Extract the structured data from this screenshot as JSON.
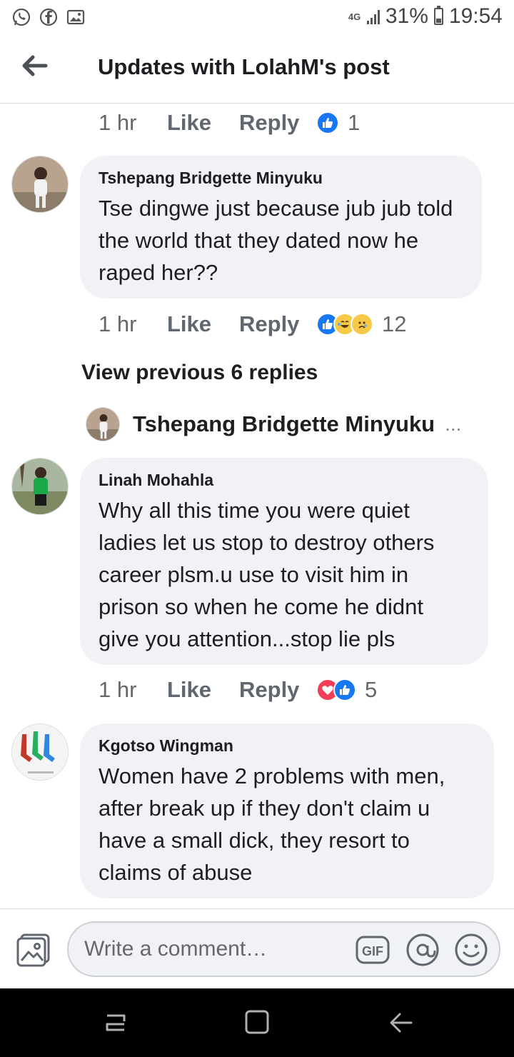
{
  "status_bar": {
    "network": "4G",
    "battery": "31%",
    "time": "19:54",
    "left_icons": [
      "whatsapp-icon",
      "facebook-icon",
      "gallery-icon"
    ]
  },
  "header": {
    "title": "Updates with LolahM's post",
    "back_icon": "back-arrow-icon"
  },
  "rows": [
    {
      "time": "1 hr",
      "like": "Like",
      "reply": "Reply",
      "reactions": [
        "like"
      ],
      "count": "1"
    },
    {
      "time": "1 hr",
      "like": "Like",
      "reply": "Reply",
      "reactions": [
        "like",
        "laugh-cry",
        "sad"
      ],
      "count": "12"
    },
    {
      "time": "1 hr",
      "like": "Like",
      "reply": "Reply",
      "reactions": [
        "love",
        "like"
      ],
      "count": "5"
    }
  ],
  "comments": [
    {
      "author": "Tshepang Bridgette Minyuku",
      "text": "Tse dingwe just because jub jub told the world that they dated now he raped her??"
    },
    {
      "author": "Linah Mohahla",
      "text": "Why all this time you were quiet ladies let us stop to destroy others career plsm.u use to visit him in prison so when he come he didnt give you attention...stop lie pls"
    },
    {
      "author": "Kgotso Wingman",
      "text": "Women have 2 problems with men, after break up if they don't claim u have a small dick, they resort to claims of abuse"
    }
  ],
  "view_previous": "View previous 6 replies",
  "reply_preview": {
    "name": "Tshepang Bridgette Minyuku",
    "more": "..."
  },
  "composer": {
    "placeholder": "Write a comment…",
    "gif_label": "GIF",
    "icons": [
      "photo-icon",
      "gif-icon",
      "mention-icon",
      "emoji-icon"
    ]
  },
  "colors": {
    "like_blue": "#1877f2",
    "love_red": "#f33e58",
    "bubble_bg": "#f0f2f5",
    "secondary_text": "#65676b"
  }
}
